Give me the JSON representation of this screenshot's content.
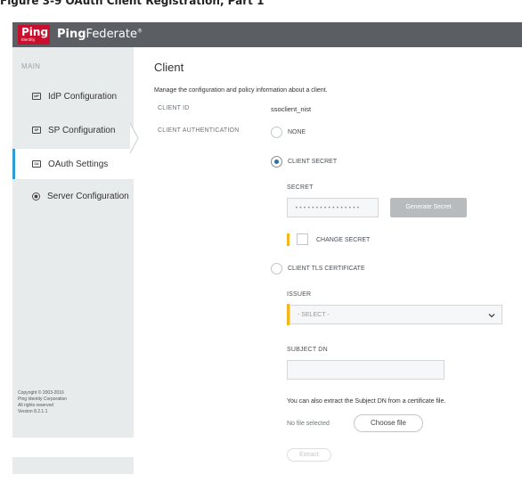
{
  "caption": "Figure 3-9 OAuth Client Registration, Part 1",
  "header": {
    "logo_text": "Ping",
    "logo_sub": "Identity",
    "brand_bold": "Ping",
    "brand_rest": "Federate",
    "brand_mark": "®"
  },
  "sidebar": {
    "heading": "MAIN",
    "items": [
      {
        "label": "IdP Configuration",
        "icon": "IdP",
        "icon_name": "idp-icon"
      },
      {
        "label": "SP Configuration",
        "icon": "SP",
        "icon_name": "sp-icon"
      },
      {
        "label": "OAuth Settings",
        "icon": "OA",
        "icon_name": "oauth-icon",
        "active": true
      },
      {
        "label": "Server Configuration",
        "icon": "",
        "icon_name": "server-icon"
      }
    ],
    "copyright": [
      "Copyright © 2003-2016",
      "Ping Identity Corporation",
      "All rights reserved",
      "Version 8.2.1.1"
    ]
  },
  "main": {
    "title": "Client",
    "description": "Manage the configuration and policy information about a client.",
    "client_id_label": "CLIENT ID",
    "client_id_value": "ssoclient_nist",
    "client_auth_label": "CLIENT AUTHENTICATION",
    "auth_options": {
      "none": "NONE",
      "secret": "CLIENT SECRET",
      "tls": "CLIENT TLS CERTIFICATE"
    },
    "selected_auth": "secret",
    "secret_label": "SECRET",
    "secret_value": "••••••••••••••••",
    "generate_button": "Generate Secret",
    "change_secret_label": "CHANGE SECRET",
    "issuer_label": "ISSUER",
    "issuer_select": "- SELECT -",
    "subject_dn_label": "SUBJECT DN",
    "subject_dn_value": "",
    "extract_note": "You can also extract the Subject DN from a certificate file.",
    "file_status": "No file selected",
    "choose_file": "Choose file",
    "extract_button": "Extract"
  },
  "colors": {
    "topbar": "#5b5f63",
    "ping_red": "#c8102e",
    "accent_blue": "#2f9bd5",
    "required_yellow": "#f2b71c",
    "sidebar_bg": "#e8ebec"
  }
}
